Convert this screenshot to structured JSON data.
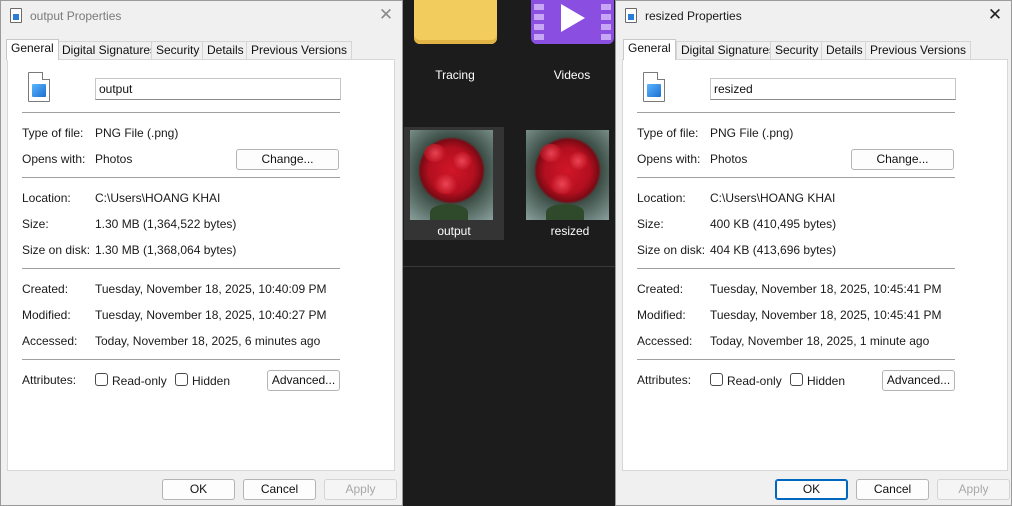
{
  "explorer": {
    "folders": [
      {
        "label": "Tracing"
      },
      {
        "label": "Videos"
      }
    ],
    "files": [
      {
        "label": "output"
      },
      {
        "label": "resized"
      }
    ]
  },
  "left": {
    "title": "output Properties",
    "tabs": [
      "General",
      "Digital Signatures",
      "Security",
      "Details",
      "Previous Versions"
    ],
    "filename": "output",
    "labels": {
      "type": "Type of file:",
      "opens": "Opens with:",
      "location": "Location:",
      "size": "Size:",
      "size_on_disk": "Size on disk:",
      "created": "Created:",
      "modified": "Modified:",
      "accessed": "Accessed:",
      "attributes": "Attributes:"
    },
    "values": {
      "type": "PNG File (.png)",
      "opens": "Photos",
      "location": "C:\\Users\\HOANG KHAI",
      "size": "1.30 MB (1,364,522 bytes)",
      "size_on_disk": "1.30 MB (1,368,064 bytes)",
      "created": "Tuesday, November 18, 2025, 10:40:09 PM",
      "modified": "Tuesday, November 18, 2025, 10:40:27 PM",
      "accessed": "Today, November 18, 2025, 6 minutes ago"
    },
    "change_label": "Change...",
    "readonly_label": "Read-only",
    "hidden_label": "Hidden",
    "advanced_label": "Advanced...",
    "ok_label": "OK",
    "cancel_label": "Cancel",
    "apply_label": "Apply"
  },
  "right": {
    "title": "resized Properties",
    "tabs": [
      "General",
      "Digital Signatures",
      "Security",
      "Details",
      "Previous Versions"
    ],
    "filename": "resized",
    "labels": {
      "type": "Type of file:",
      "opens": "Opens with:",
      "location": "Location:",
      "size": "Size:",
      "size_on_disk": "Size on disk:",
      "created": "Created:",
      "modified": "Modified:",
      "accessed": "Accessed:",
      "attributes": "Attributes:"
    },
    "values": {
      "type": "PNG File (.png)",
      "opens": "Photos",
      "location": "C:\\Users\\HOANG KHAI",
      "size": "400 KB (410,495 bytes)",
      "size_on_disk": "404 KB (413,696 bytes)",
      "created": "Tuesday, November 18, 2025, 10:45:41 PM",
      "modified": "Tuesday, November 18, 2025, 10:45:41 PM",
      "accessed": "Today, November 18, 2025, 1 minute ago"
    },
    "change_label": "Change...",
    "readonly_label": "Read-only",
    "hidden_label": "Hidden",
    "advanced_label": "Advanced...",
    "ok_label": "OK",
    "cancel_label": "Cancel",
    "apply_label": "Apply"
  },
  "close_glyph": "✕"
}
